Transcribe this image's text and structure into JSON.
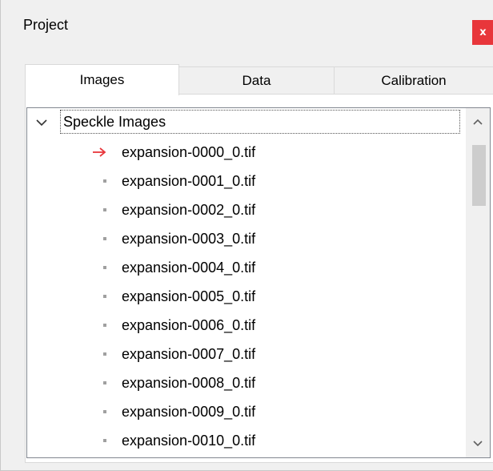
{
  "window": {
    "title": "Project",
    "close_label": "x"
  },
  "tabs": [
    {
      "label": "Images",
      "active": true
    },
    {
      "label": "Data",
      "active": false
    },
    {
      "label": "Calibration",
      "active": false
    }
  ],
  "tree": {
    "root": {
      "label": "Speckle Images",
      "expanded": true
    },
    "items": [
      {
        "label": "expansion-0000_0.tif",
        "marker": "arrow-right-icon",
        "current": true
      },
      {
        "label": "expansion-0001_0.tif",
        "marker": "bullet-icon"
      },
      {
        "label": "expansion-0002_0.tif",
        "marker": "bullet-icon"
      },
      {
        "label": "expansion-0003_0.tif",
        "marker": "bullet-icon"
      },
      {
        "label": "expansion-0004_0.tif",
        "marker": "bullet-icon"
      },
      {
        "label": "expansion-0005_0.tif",
        "marker": "bullet-icon"
      },
      {
        "label": "expansion-0006_0.tif",
        "marker": "bullet-icon"
      },
      {
        "label": "expansion-0007_0.tif",
        "marker": "bullet-icon"
      },
      {
        "label": "expansion-0008_0.tif",
        "marker": "bullet-icon"
      },
      {
        "label": "expansion-0009_0.tif",
        "marker": "bullet-icon"
      },
      {
        "label": "expansion-0010_0.tif",
        "marker": "bullet-icon"
      }
    ]
  },
  "colors": {
    "close_button": "#e8363b",
    "current_arrow": "#e8363b",
    "bullet": "#a0a0a0"
  }
}
